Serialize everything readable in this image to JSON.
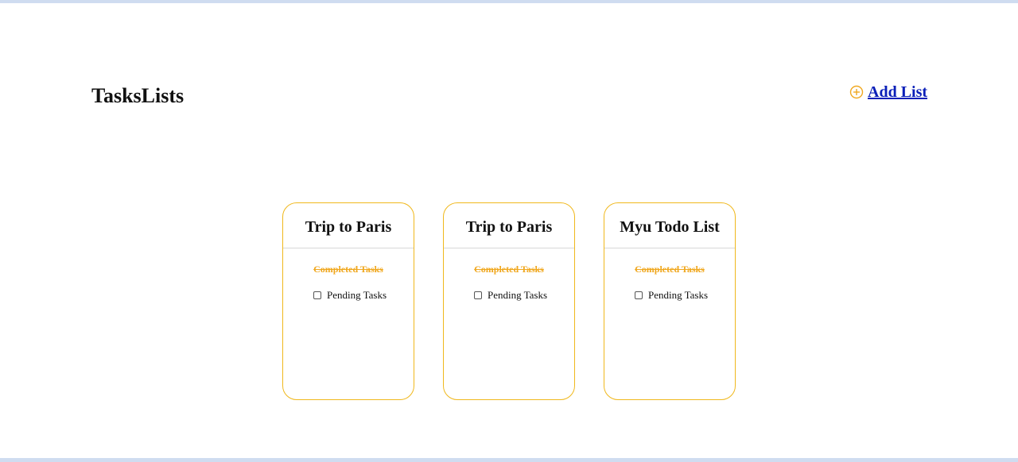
{
  "header": {
    "title": "TasksLists",
    "add_list_label": "Add List",
    "add_icon": "plus-circle-icon"
  },
  "colors": {
    "accent": "#f0b81c",
    "completed_text": "#f0a820",
    "link": "#0a1fb8",
    "frame": "#cfdcf0"
  },
  "lists": [
    {
      "title": "Trip to Paris",
      "completed_label": "Completed Tasks",
      "pending_label": "Pending Tasks",
      "pending_checked": false
    },
    {
      "title": "Trip to Paris",
      "completed_label": "Completed Tasks",
      "pending_label": "Pending Tasks",
      "pending_checked": false
    },
    {
      "title": "Myu Todo List",
      "completed_label": "Completed Tasks",
      "pending_label": "Pending Tasks",
      "pending_checked": false
    }
  ]
}
